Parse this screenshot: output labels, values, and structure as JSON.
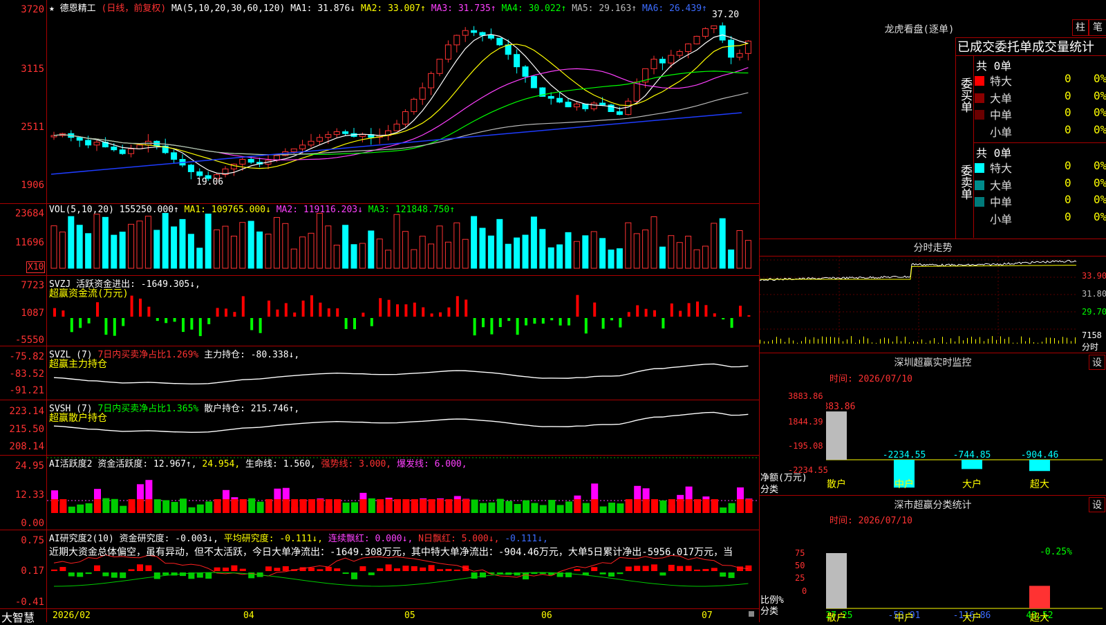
{
  "header": {
    "star": "★",
    "name": "德恩精工",
    "period": "(日线，前复权)",
    "ma_label": "MA(5,10,20,30,60,120)",
    "ma1": "MA1: 31.876↓",
    "ma2": "MA2: 33.007↑",
    "ma3": "MA3: 31.735↑",
    "ma4": "MA4: 30.022↑",
    "ma5": "MA5: 29.163↑",
    "ma6": "MA6: 26.439↑"
  },
  "main_axis": [
    "3720",
    "3115",
    "2511",
    "1906"
  ],
  "price_marks": {
    "high": "37.20",
    "low": "19.06"
  },
  "vol": {
    "label": "VOL(5,10,20)",
    "value": "155250.000↑",
    "ma1": "MA1: 109765.000↓",
    "ma2": "MA2: 119116.203↓",
    "ma3": "MA3: 121848.750↑",
    "axis": [
      "23684",
      "11696"
    ],
    "unit": "X10"
  },
  "svzj": {
    "line1": "SVZJ  活跃资金进出: -1649.305↓,",
    "line2": "超赢资金流(万元)",
    "axis": [
      "7723",
      "1087",
      "-5550"
    ]
  },
  "svzl": {
    "prefix": "SVZL (7)",
    "desc": "7日内买卖净占比1.269%",
    "val": "主力持仓: -80.338↓,",
    "line2": "超赢主力持仓",
    "axis": [
      "-75.82",
      "-83.52",
      "-91.21"
    ]
  },
  "svsh": {
    "prefix": "SVSH (7)",
    "desc": "7日内买卖净占比1.365%",
    "val": "散户持仓: 215.746↑,",
    "line2": "超赢散户持仓",
    "axis": [
      "223.14",
      "215.50",
      "208.14"
    ]
  },
  "ai1": {
    "label": "AI活跃度2",
    "a": "资金活跃度: 12.967↑,",
    "b": "24.954,",
    "c": "生命线: 1.560,",
    "d": "强势线: 3.000,",
    "e": "爆发线: 6.000,",
    "axis": [
      "24.95",
      "12.33",
      "0.00"
    ]
  },
  "ai2": {
    "label": "AI研究度2(10)",
    "a": "资金研究度: -0.003↓,",
    "b": "平均研究度: -0.111↓,",
    "c": "连续飘红: 0.000↓,",
    "d": "N日飘红: 5.000↓,",
    "e": "-0.111↓,",
    "summary": "近期大资金总体偏空，虽有异动，但不太活跃，今日大单净流出：-1649.308万元，其中特大单净流出：-904.46万元，大单5日累计净出-5956.017万元，当",
    "axis": [
      "0.75",
      "0.17",
      "-0.41"
    ]
  },
  "bottom": {
    "brand": "大智慧",
    "dates": [
      "2026/02",
      "04",
      "05",
      "06",
      "07"
    ]
  },
  "lhb": {
    "title": "龙虎看盘(逐单)",
    "btn1": "柱",
    "btn2": "笔",
    "tabs": "已成交委托单成交量统计",
    "buy_label": "委买单",
    "sell_label": "委卖单",
    "buy_total": "共 0单",
    "sell_total": "共 0单",
    "buy_rows": [
      {
        "name": "特大",
        "count": "0",
        "pct": "0%",
        "color": "#ff0000"
      },
      {
        "name": "大单",
        "count": "0",
        "pct": "0%",
        "color": "#8b0000"
      },
      {
        "name": "中单",
        "count": "0",
        "pct": "0%",
        "color": "#6b0000"
      },
      {
        "name": "小单",
        "count": "0",
        "pct": "0%",
        "color": ""
      }
    ],
    "sell_rows": [
      {
        "name": "特大",
        "count": "0",
        "pct": "0%",
        "color": "#00ffff"
      },
      {
        "name": "大单",
        "count": "0",
        "pct": "0%",
        "color": "#008b8b"
      },
      {
        "name": "中单",
        "count": "0",
        "pct": "0%",
        "color": "#007a7a"
      },
      {
        "name": "小单",
        "count": "0",
        "pct": "0%",
        "color": ""
      }
    ]
  },
  "intraday": {
    "title": "分时走势",
    "axis": [
      "33.90",
      "31.80",
      "29.70",
      "7158",
      "分时"
    ]
  },
  "sz_monitor": {
    "title": "深圳超赢实时监控",
    "btn": "设",
    "time": "时间: 2026/07/10",
    "axis": [
      "3883.86",
      "1844.39",
      "-195.08",
      "-2234.55"
    ],
    "unit": "净额(万元)",
    "cat_label": "分类",
    "cats": [
      "散户",
      "中户",
      "大户",
      "超大"
    ],
    "values": [
      "3883.86",
      "-2234.55",
      "-744.85",
      "-904.46"
    ]
  },
  "sz_class": {
    "title": "深市超赢分类统计",
    "btn": "设",
    "time": "时间: 2026/07/10",
    "axis": [
      "75",
      "50",
      "25",
      "0"
    ],
    "unit": "比例%",
    "cat_label": "分类",
    "cats": [
      "散户",
      "中户",
      "大户",
      "超大"
    ],
    "values": [
      "227.25",
      "-53.91",
      "-116.86",
      "43.52"
    ],
    "top_label": "-0.25%"
  }
}
